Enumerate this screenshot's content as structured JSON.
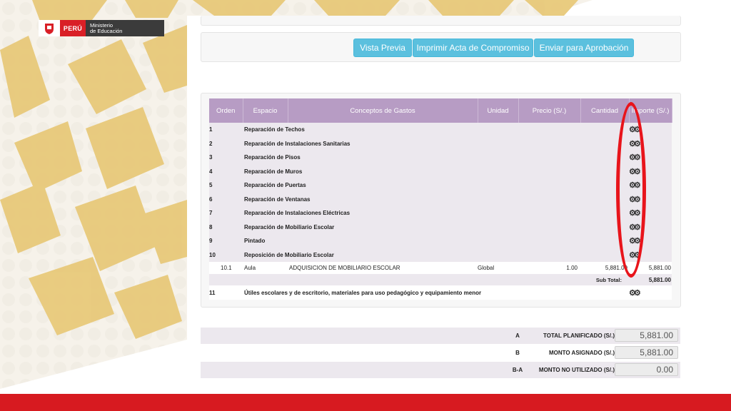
{
  "header": {
    "peru": "PERÚ",
    "ministry_line1": "Ministerio",
    "ministry_line2": "de Educación"
  },
  "toolbar": {
    "vista_previa": "Vista Previa",
    "imprimir": "Imprimir Acta de Compromiso",
    "enviar": "Enviar para Aprobación"
  },
  "table": {
    "headers": [
      "Orden",
      "Espacio",
      "Conceptos de Gastos",
      "Unidad",
      "Precio (S/.)",
      "Cantidad",
      "Importe (S/.)"
    ],
    "categories": [
      {
        "orden": "1",
        "name": "Reparación de Techos"
      },
      {
        "orden": "2",
        "name": "Reparación de Instalaciones Sanitarias"
      },
      {
        "orden": "3",
        "name": "Reparación de Pisos"
      },
      {
        "orden": "4",
        "name": "Reparación de Muros"
      },
      {
        "orden": "5",
        "name": "Reparación de Puertas"
      },
      {
        "orden": "6",
        "name": "Reparación de Ventanas"
      },
      {
        "orden": "7",
        "name": "Reparación de Instalaciones Eléctricas"
      },
      {
        "orden": "8",
        "name": "Reparación de Mobiliario Escolar"
      },
      {
        "orden": "9",
        "name": "Pintado"
      },
      {
        "orden": "10",
        "name": "Reposición de Mobiliario Escolar"
      }
    ],
    "detail": {
      "orden": "10.1",
      "espacio": "Aula",
      "concepto": "ADQUISICION DE MOBILIARIO ESCOLAR",
      "unidad": "Global",
      "precio": "1.00",
      "cantidad": "5,881.00",
      "importe": "5,881.00"
    },
    "subtotal_label": "Sub Total:",
    "subtotal_value": "5,881.00",
    "category11": {
      "orden": "11",
      "name": "Útiles escolares y de escritorio, materiales para uso pedagógico y equipamiento menor"
    }
  },
  "summary": [
    {
      "code": "A",
      "label": "TOTAL PLANIFICADO  (S/.)",
      "value": "5,881.00"
    },
    {
      "code": "B",
      "label": "MONTO ASIGNADO  (S/.)",
      "value": "5,881.00"
    },
    {
      "code": "B-A",
      "label": "MONTO NO UTILIZADO  (S/.)",
      "value": "0.00"
    }
  ],
  "colors": {
    "table_header": "#b79cc4",
    "button": "#5bc0de",
    "highlight": "#e8141b",
    "footer_bar": "#d71a20",
    "background_pattern": "#e8c97a"
  },
  "icons": {
    "row_action": "gears-icon",
    "brand": "shield-icon"
  }
}
